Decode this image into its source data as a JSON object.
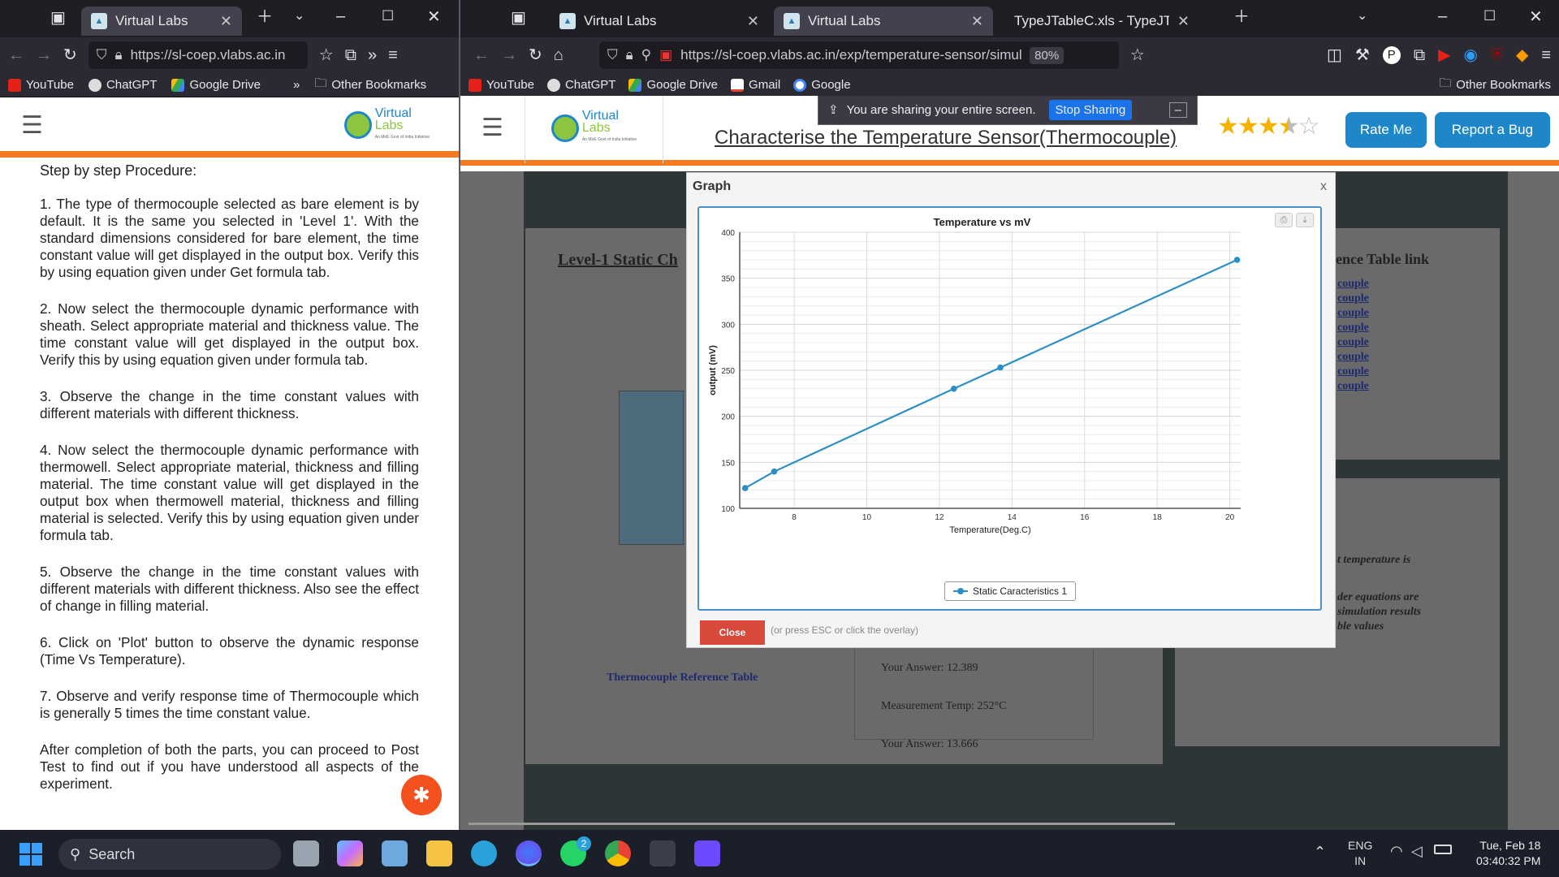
{
  "left_window": {
    "tabs": [
      {
        "title": "Virtual Labs",
        "active": true
      }
    ],
    "url": "https://sl-coep.vlabs.ac.in",
    "bookmarks": [
      "YouTube",
      "ChatGPT",
      "Google Drive"
    ],
    "other_bookmarks": "Other Bookmarks",
    "logo_top": "Virtual",
    "logo_bottom": "Labs",
    "logo_tag": "An MoE Govt of India Initiative",
    "procedure": {
      "heading": "Step by step Procedure:",
      "steps": [
        "1. The type of thermocouple selected as bare element is by default. It is the same you selected in 'Level 1'. With the standard dimensions considered for bare element, the time constant value will get displayed in the output box. Verify this by using equation given under Get formula tab.",
        "2. Now select the thermocouple dynamic performance with sheath. Select appropriate material and thickness value. The time constant value will get displayed in the output box. Verify this by using equation given under formula tab.",
        "3. Observe the change in the time constant values with different materials with different thickness.",
        "4. Now select the thermocouple dynamic performance with thermowell. Select appropriate material, thickness and filling material. The time constant value will get displayed in the output box when thermowell material, thickness and filling material is selected. Verify this by using equation given under formula tab.",
        "5. Observe the change in the time constant values with different materials with different thickness. Also see the effect of change in filling material.",
        "6. Click on 'Plot' button to observe the dynamic response (Time Vs Temperature).",
        "7. Observe and verify response time of Thermocouple which is generally 5 times the time constant value.",
        "After completion of both the parts, you can proceed to Post Test to find out if you have understood all aspects of the experiment."
      ]
    }
  },
  "right_window": {
    "tabs": [
      {
        "title": "Virtual Labs",
        "active": false
      },
      {
        "title": "Virtual Labs",
        "active": true
      },
      {
        "title": "TypeJTableC.xls - TypeJTableC.p",
        "active": false
      }
    ],
    "url": "https://sl-coep.vlabs.ac.in/exp/temperature-sensor/simulation.",
    "zoom": "80%",
    "bookmarks": [
      "YouTube",
      "ChatGPT",
      "Google Drive",
      "Gmail",
      "Google"
    ],
    "other_bookmarks": "Other Bookmarks",
    "sharing": {
      "text": "You are sharing your entire screen.",
      "stop": "Stop Sharing"
    },
    "page_title": "Characterise the Temperature Sensor(Thermocouple)",
    "rating_stars": 3.5,
    "rate_me": "Rate Me",
    "report_bug": "Report a Bug",
    "bg": {
      "level_title": "Level-1 Static Ch",
      "ref_table_link_title": "ence Table link",
      "ref_links": [
        "couple",
        "couple",
        "couple",
        "couple",
        "couple",
        "couple",
        "couple",
        "couple"
      ],
      "ref_table_label": "Thermocouple Reference Table",
      "answer1": "Your Answer: 12.389",
      "measurement": "Measurement Temp: 252°C",
      "answer2": "Your Answer: 13.666",
      "side_text1": "t temperature is",
      "side_text2": "der equations are",
      "side_text3": "simulation results",
      "side_text4": "ble values"
    },
    "modal": {
      "title": "Graph",
      "close_x": "x",
      "close_btn": "Close",
      "hint": "(or press ESC or click the overlay)"
    }
  },
  "chart_data": {
    "type": "line",
    "title": "Temperature vs mV",
    "xlabel": "Temperature(Deg.C)",
    "ylabel": "output (mV)",
    "xlim": [
      6.5,
      20.3
    ],
    "ylim": [
      100,
      400
    ],
    "xticks": [
      8,
      10,
      12,
      14,
      16,
      18,
      20
    ],
    "yticks": [
      100,
      150,
      200,
      250,
      300,
      350,
      400
    ],
    "series": [
      {
        "name": "Static Caracteristics 1",
        "color": "#2b8fc6",
        "x": [
          6.65,
          7.45,
          12.4,
          13.68,
          20.2
        ],
        "y": [
          122,
          140,
          230,
          253,
          370
        ]
      }
    ],
    "legend_position": "bottom-center"
  },
  "taskbar": {
    "search": "Search",
    "lang_top": "ENG",
    "lang_bottom": "IN",
    "date": "Tue, Feb 18",
    "time": "03:40:32 PM",
    "whatsapp_badge": "2"
  }
}
